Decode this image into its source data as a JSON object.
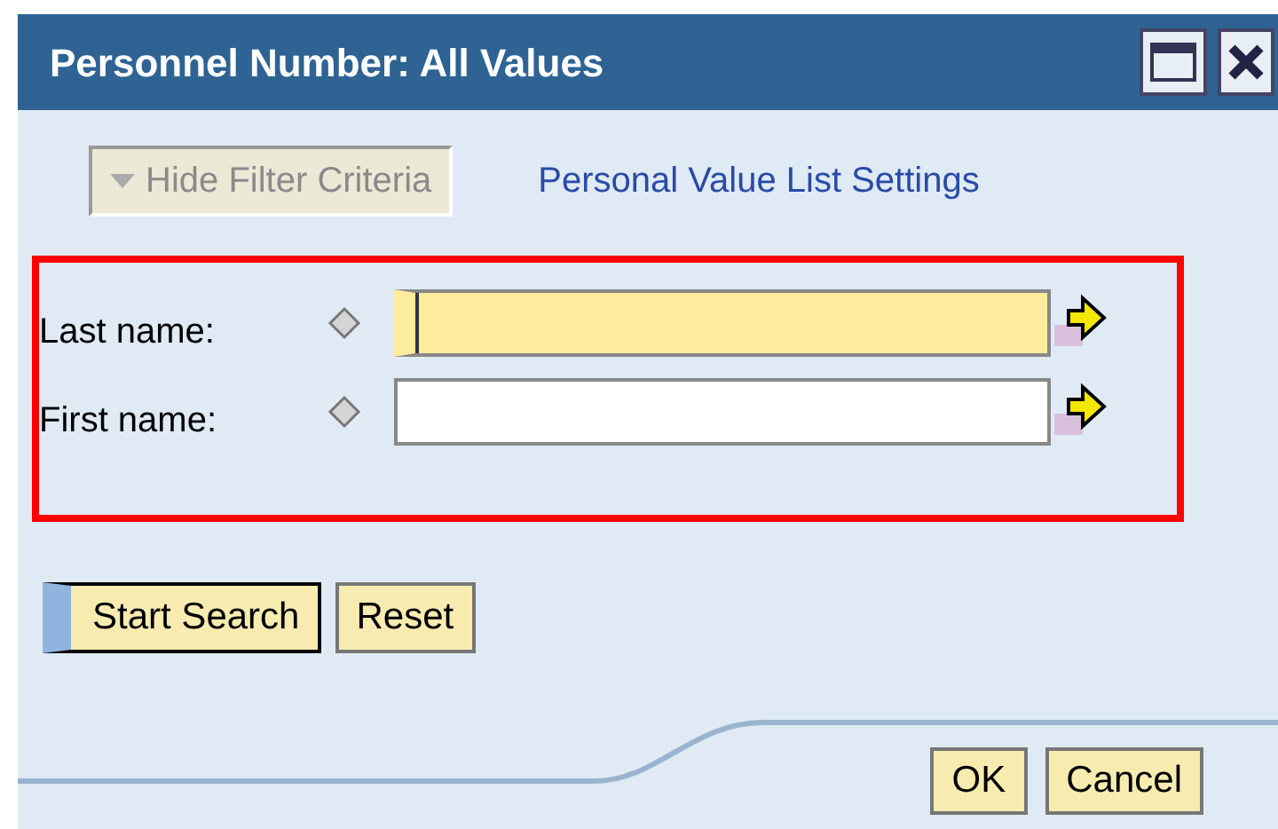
{
  "window": {
    "title": "Personnel Number: All Values"
  },
  "toolbar": {
    "filter_toggle": {
      "label": "Hide Filter Criteria",
      "disabled": true
    },
    "link": "Personal Value List Settings"
  },
  "fields": [
    {
      "label": "Last name:",
      "focused": true
    },
    {
      "label": "First name:",
      "focused": false
    }
  ],
  "search_buttons": [
    {
      "label": "Start Search",
      "primary": true
    },
    {
      "label": "Reset",
      "primary": false
    }
  ],
  "footer_buttons": [
    "OK",
    "Cancel"
  ]
}
